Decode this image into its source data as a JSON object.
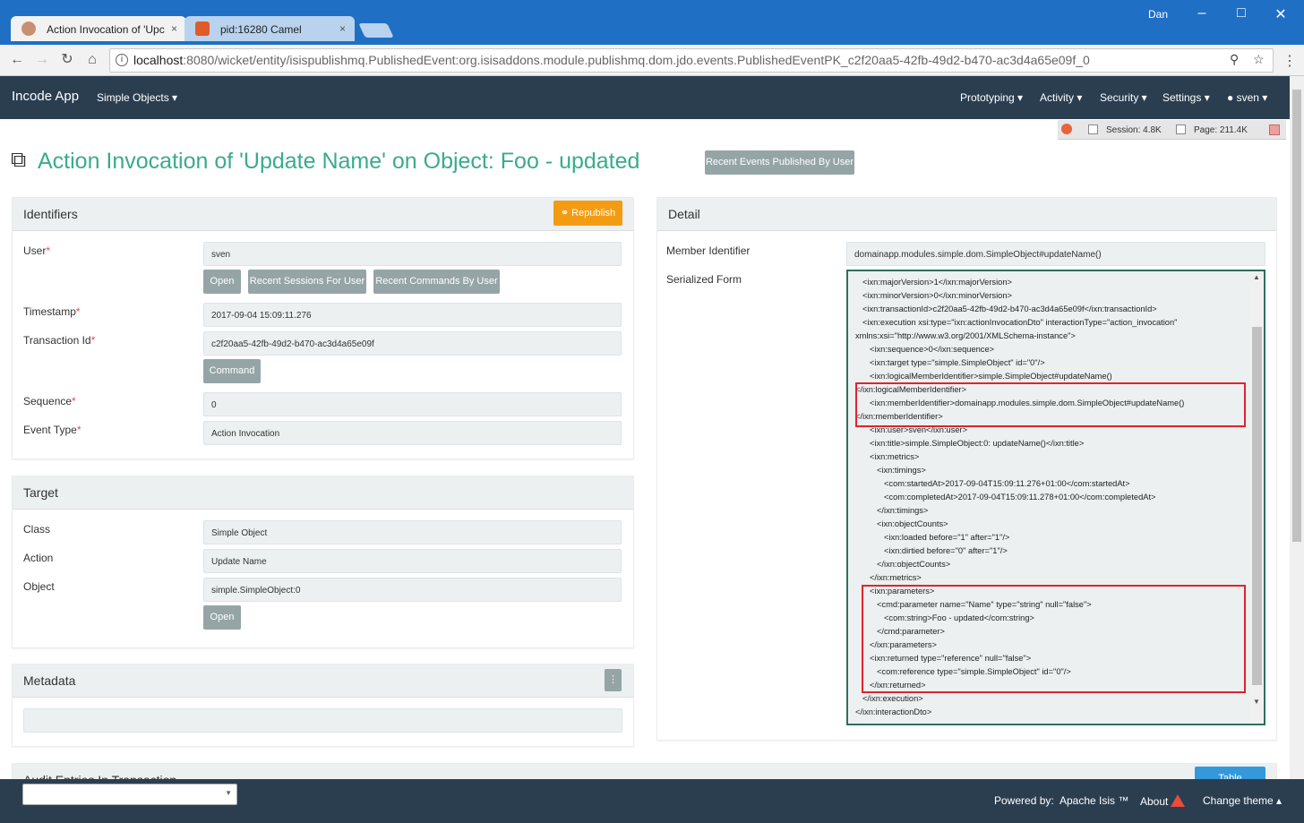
{
  "browser": {
    "tabs": [
      {
        "label": "Action Invocation of 'Upc",
        "close": "×"
      },
      {
        "label": "pid:16280 Camel",
        "close": "×"
      }
    ],
    "window_user": "Dan",
    "url_host": "localhost",
    "url_rest": ":8080/wicket/entity/isispublishmq.PublishedEvent:org.isisaddons.module.publishmq.dom.jdo.events.PublishedEventPK_c2f20aa5-42fb-49d2-b470-ac3d4a65e09f_0"
  },
  "appnav": {
    "brand": "Incode App",
    "menu_simple_objects": "Simple Objects ▾",
    "prototyping": "Prototyping ▾",
    "activity": "Activity ▾",
    "security": "Security ▾",
    "settings": "Settings ▾",
    "user": "sven ▾"
  },
  "debug": {
    "session": "Session: 4.8K",
    "page": "Page: 211.4K"
  },
  "page": {
    "title": "Action Invocation of 'Update Name' on Object: Foo - updated",
    "recent_events_button": "Recent Events Published By User"
  },
  "identifiers": {
    "heading": "Identifiers",
    "republish": "Republish",
    "user_label": "User",
    "user_value": "sven",
    "open": "Open",
    "recent_sessions": "Recent Sessions For User",
    "recent_commands": "Recent Commands By User",
    "timestamp_label": "Timestamp",
    "timestamp_value": "2017-09-04 15:09:11.276",
    "transaction_label": "Transaction Id",
    "transaction_value": "c2f20aa5-42fb-49d2-b470-ac3d4a65e09f",
    "command": "Command",
    "sequence_label": "Sequence",
    "sequence_value": "0",
    "event_type_label": "Event Type",
    "event_type_value": "Action Invocation",
    "required_mark": "*"
  },
  "target": {
    "heading": "Target",
    "class_label": "Class",
    "class_value": "Simple Object",
    "action_label": "Action",
    "action_value": "Update Name",
    "object_label": "Object",
    "object_value": "simple.SimpleObject:0",
    "open": "Open"
  },
  "metadata": {
    "heading": "Metadata",
    "menu": "⋮"
  },
  "audit": {
    "heading": "Audit Entries In Transaction",
    "table_btn": "Table"
  },
  "detail": {
    "heading": "Detail",
    "member_label": "Member Identifier",
    "member_value": "domainapp.modules.simple.dom.SimpleObject#updateName()",
    "serialized_label": "Serialized Form",
    "xml_lines": [
      "<ixn:majorVersion>1</ixn:majorVersion>",
      "<ixn:minorVersion>0</ixn:minorVersion>",
      "<ixn:transactionId>c2f20aa5-42fb-49d2-b470-ac3d4a65e09f</ixn:transactionId>",
      "<ixn:execution xsi:type=\"ixn:actionInvocationDto\" interactionType=\"action_invocation\"",
      "xmlns:xsi=\"http://www.w3.org/2001/XMLSchema-instance\">",
      "<ixn:sequence>0</ixn:sequence>",
      "<ixn:target type=\"simple.SimpleObject\" id=\"0\"/>",
      "<ixn:logicalMemberIdentifier>simple.SimpleObject#updateName()",
      "</ixn:logicalMemberIdentifier>",
      "<ixn:memberIdentifier>domainapp.modules.simple.dom.SimpleObject#updateName()",
      "</ixn:memberIdentifier>",
      "<ixn:user>sven</ixn:user>",
      "<ixn:title>simple.SimpleObject:0: updateName()</ixn:title>",
      "<ixn:metrics>",
      "<ixn:timings>",
      "<com:startedAt>2017-09-04T15:09:11.276+01:00</com:startedAt>",
      "<com:completedAt>2017-09-04T15:09:11.278+01:00</com:completedAt>",
      "</ixn:timings>",
      "<ixn:objectCounts>",
      "<ixn:loaded before=\"1\" after=\"1\"/>",
      "<ixn:dirtied before=\"0\" after=\"1\"/>",
      "</ixn:objectCounts>",
      "</ixn:metrics>",
      "<ixn:parameters>",
      "<cmd:parameter name=\"Name\" type=\"string\" null=\"false\">",
      "<com:string>Foo - updated</com:string>",
      "</cmd:parameter>",
      "</ixn:parameters>",
      "<ixn:returned type=\"reference\" null=\"false\">",
      "<com:reference type=\"simple.SimpleObject\" id=\"0\"/>",
      "</ixn:returned>",
      "</ixn:execution>",
      "</ixn:interactionDto>"
    ]
  },
  "footer": {
    "powered_by": "Powered by:",
    "isis": "Apache Isis ™",
    "about": "About",
    "change_theme": "Change theme ▴"
  }
}
